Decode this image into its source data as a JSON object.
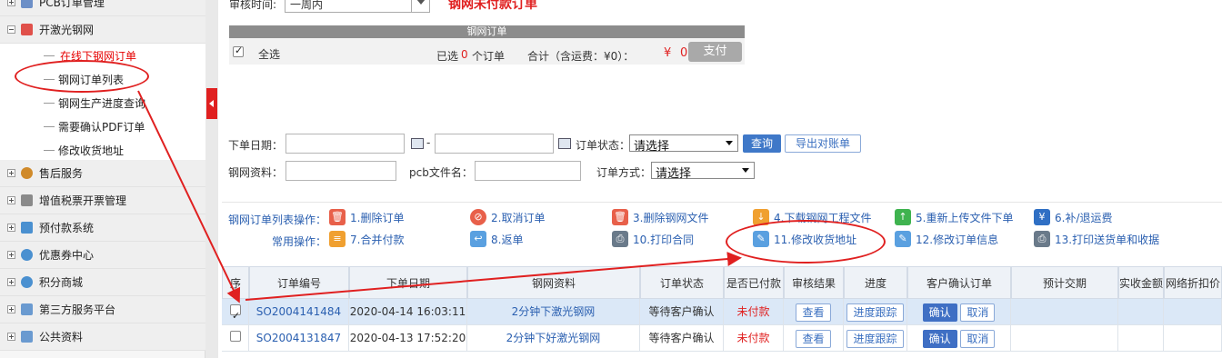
{
  "sidebar": {
    "groups_top": [
      {
        "label": "PCB订单管理",
        "icon": "pcb-icon",
        "color": "#6c8fc7"
      },
      {
        "label": "开激光钢网",
        "icon": "stencil-icon",
        "color": "#e0504a"
      }
    ],
    "subitems": [
      {
        "label": "在线下钢网订单",
        "active": true
      },
      {
        "label": "钢网订单列表"
      },
      {
        "label": "钢网生产进度查询"
      },
      {
        "label": "需要确认PDF订单"
      },
      {
        "label": "修改收货地址"
      }
    ],
    "groups_bottom": [
      {
        "label": "售后服务",
        "icon": "service-icon",
        "color": "#d08a2a"
      },
      {
        "label": "增值税票开票管理",
        "icon": "invoice-icon",
        "color": "#8a8a8a"
      },
      {
        "label": "预付款系统",
        "icon": "prepay-icon",
        "color": "#4a90d0"
      },
      {
        "label": "优惠券中心",
        "icon": "coupon-icon",
        "color": "#4a90d0"
      },
      {
        "label": "积分商城",
        "icon": "points-icon",
        "color": "#4a90d0"
      },
      {
        "label": "第三方服务平台",
        "icon": "platform-icon",
        "color": "#6a9ad0"
      },
      {
        "label": "公共资料",
        "icon": "docs-icon",
        "color": "#6a9ad0"
      }
    ]
  },
  "top": {
    "audit_label": "审核时间:",
    "audit_value": "一周内",
    "unpaid_title": "钢网未付款订单"
  },
  "stencil_box": {
    "bar_title": "钢网订单",
    "select_all": "全选",
    "selected_prefix": "已选",
    "selected_count": "0",
    "selected_suffix": "个订单",
    "total_label": "合计（含运费：¥0）：",
    "currency": "¥",
    "total_value": "0",
    "pay_label": "支付"
  },
  "search": {
    "order_date_label": "下单日期：",
    "range_sep": "-",
    "order_status_label": "订单状态：",
    "order_status_value": "请选择",
    "query_label": "查询",
    "export_label": "导出对账单",
    "stencil_material_label": "钢网资料：",
    "pcb_file_label": "pcb文件名：",
    "order_method_label": "订单方式：",
    "order_method_value": "请选择"
  },
  "ops": {
    "row1_label": "钢网订单列表操作：",
    "row2_label": "常用操作：",
    "row1": [
      {
        "label": "1.删除订单",
        "icon": "trash-icon",
        "color": "#e8604a"
      },
      {
        "label": "2.取消订单",
        "icon": "cancel-icon",
        "color": "#e8604a"
      },
      {
        "label": "3.删除钢网文件",
        "icon": "trash-icon",
        "color": "#e8604a"
      },
      {
        "label": "4.下载钢网工程文件",
        "icon": "download-icon",
        "color": "#f0a030"
      },
      {
        "label": "5.重新上传文件下单",
        "icon": "upload-icon",
        "color": "#3fb34f"
      },
      {
        "label": "6.补/退运费",
        "icon": "refund-icon",
        "color": "#2f6fc4"
      }
    ],
    "row2": [
      {
        "label": "7.合并付款",
        "icon": "coins-icon",
        "color": "#f0a030"
      },
      {
        "label": "8.返单",
        "icon": "return-icon",
        "color": "#5aa0e0"
      },
      {
        "label": "10.打印合同",
        "icon": "printer-icon",
        "color": "#6a7a8a"
      },
      {
        "label": "11.修改收货地址",
        "icon": "edit-icon",
        "color": "#5aa0e0"
      },
      {
        "label": "12.修改订单信息",
        "icon": "edit-icon",
        "color": "#5aa0e0"
      },
      {
        "label": "13.打印送货单和收据",
        "icon": "printer-icon",
        "color": "#6a7a8a"
      }
    ]
  },
  "table": {
    "headers": [
      "序",
      "订单编号",
      "下单日期",
      "钢网资料",
      "订单状态",
      "是否已付款",
      "审核结果",
      "进度",
      "客户确认订单",
      "预计交期",
      "实收金额",
      "网络折扣价"
    ],
    "rows": [
      {
        "checked": true,
        "order_no": "SO2004141484",
        "date": "2020-04-14 16:03:11",
        "material": "2分钟下激光钢网",
        "status": "等待客户确认",
        "paid": "未付款",
        "audit": "查看",
        "progress": "进度跟踪",
        "confirm": "确认",
        "cancel": "取消"
      },
      {
        "checked": false,
        "order_no": "SO2004131847",
        "date": "2020-04-13 17:52:20",
        "material": "2分钟下好激光钢网",
        "status": "等待客户确认",
        "paid": "未付款",
        "audit": "查看",
        "progress": "进度跟踪",
        "confirm": "确认",
        "cancel": "取消"
      }
    ]
  },
  "colors": {
    "accent_red": "#e02020",
    "link_blue": "#2a5fb0",
    "button_blue": "#3f78c8"
  }
}
